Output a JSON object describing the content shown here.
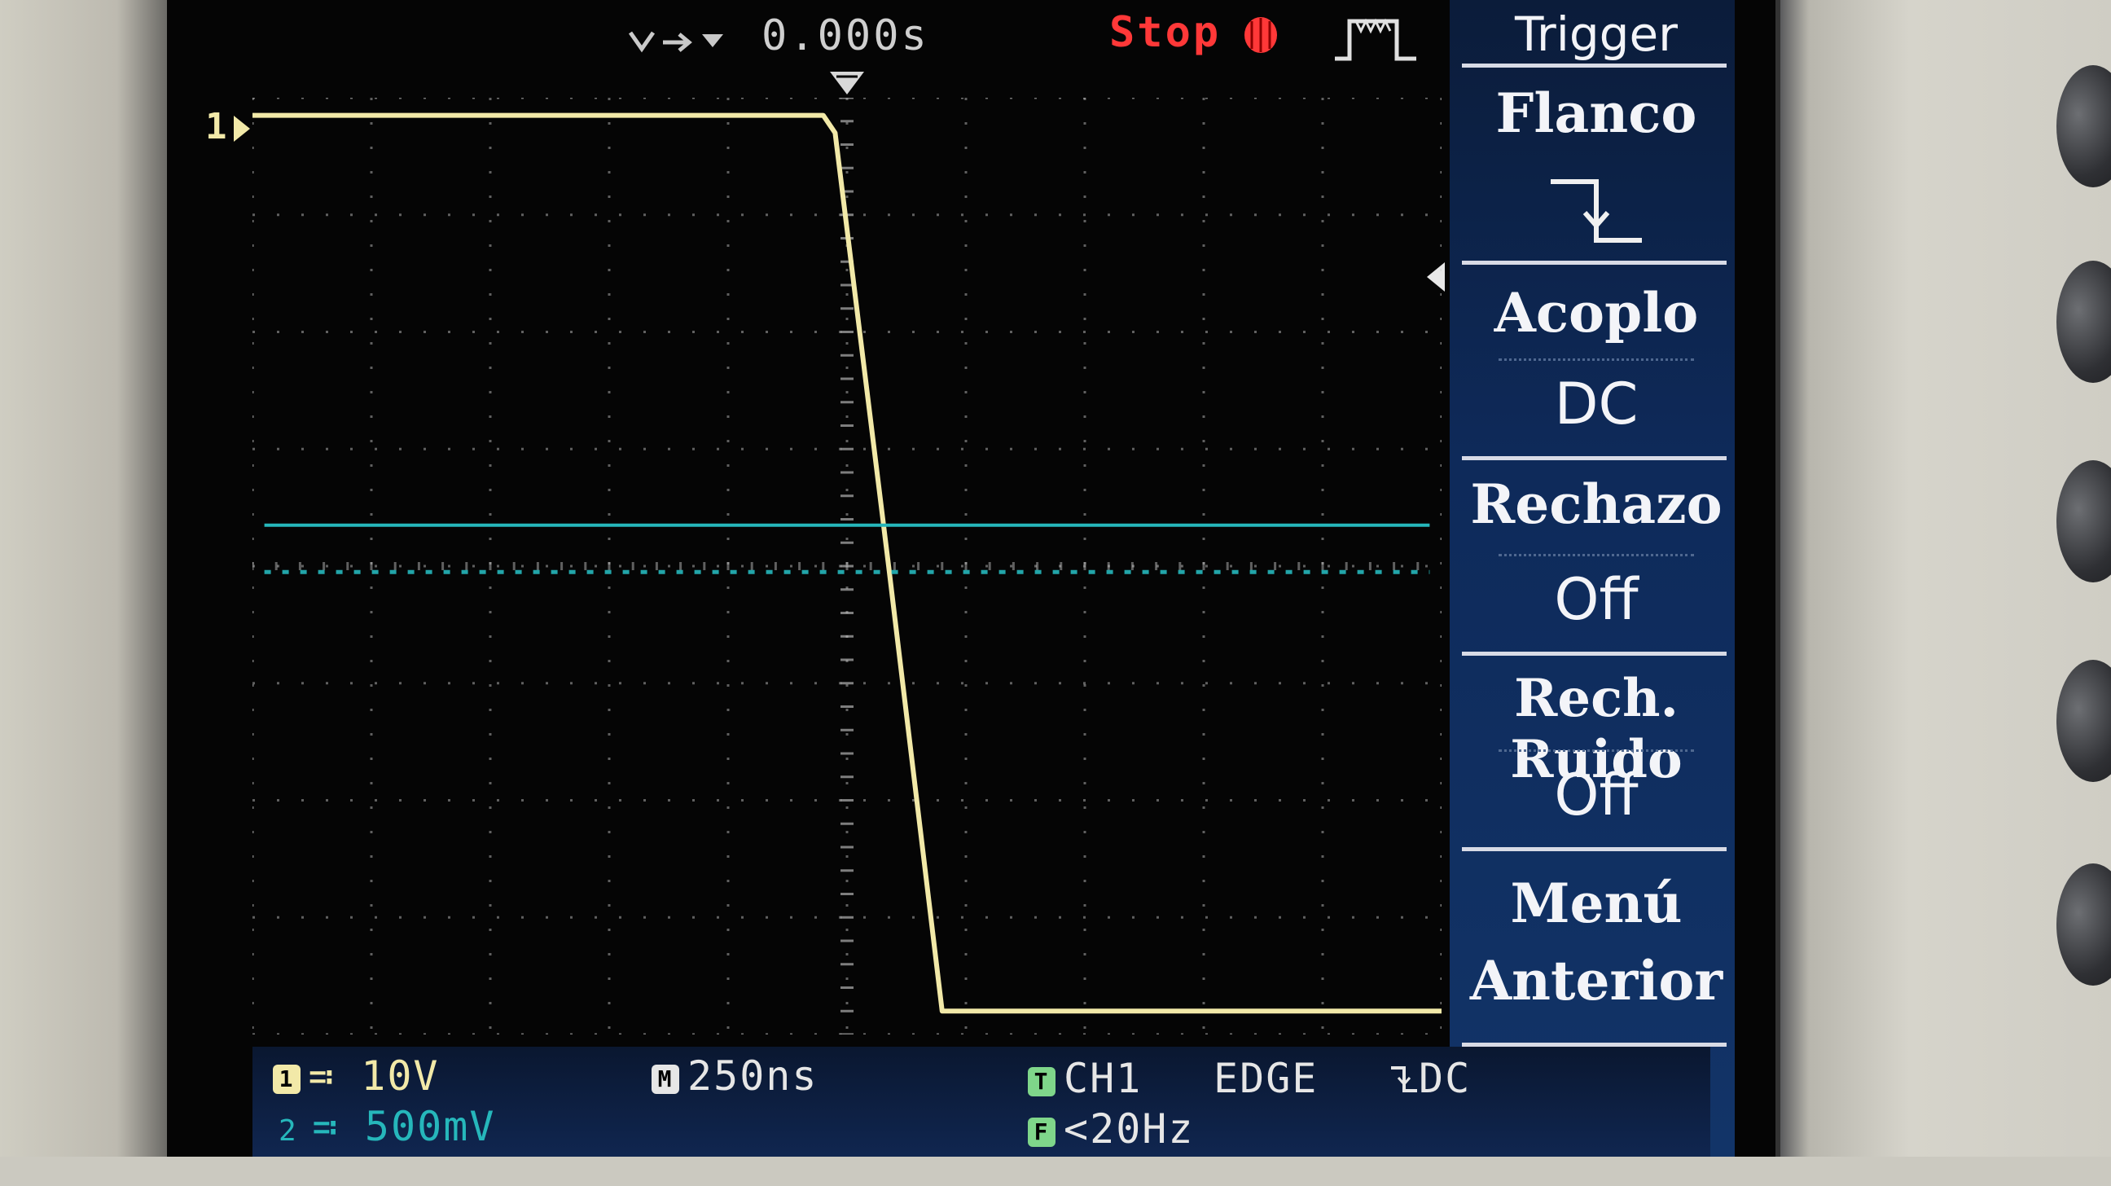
{
  "top_bar": {
    "time_offset": "0.000s",
    "run_state": "Stop",
    "run_state_color": "#ff3838",
    "trigger_position_marker": "T",
    "ch1_marker": "1"
  },
  "trigger_menu": {
    "title": "Trigger",
    "items": [
      {
        "label": "Flanco",
        "value_icon": "falling-edge-icon"
      },
      {
        "label": "Acoplo",
        "value": "DC"
      },
      {
        "label": "Rechazo",
        "value": "Off"
      },
      {
        "label": "Rech. Ruido",
        "value": "Off"
      },
      {
        "label": "Menú",
        "label2": "Anterior"
      }
    ]
  },
  "status_bar": {
    "ch1_index": "1",
    "ch1_scale": "10V",
    "ch2_index": "2",
    "ch2_scale": "500mV",
    "time_badge": "M",
    "timebase": "250ns",
    "trig_badge": "T",
    "trig_source": "CH1",
    "trig_type": "EDGE",
    "trig_coupling": "DC",
    "freq_badge": "F",
    "frequency": "<20Hz"
  },
  "colors": {
    "ch1": "#f2e9a8",
    "ch2": "#26b7bb",
    "grid": "#cfcfcf",
    "menu_bg": "#0f2c5e",
    "stop": "#ff3838"
  },
  "chart_data": {
    "type": "line",
    "title": "",
    "xlabel": "",
    "ylabel": "",
    "timebase_per_div": "250ns",
    "divisions": {
      "x": 10,
      "y": 8
    },
    "xlim_div": [
      -5,
      5
    ],
    "ylim_div": [
      -4,
      4
    ],
    "series": [
      {
        "name": "1",
        "color": "#f2e9a8",
        "points_div": [
          [
            -5,
            3.85
          ],
          [
            -0.2,
            3.85
          ],
          [
            -0.1,
            3.7
          ],
          [
            0.35,
            0.0
          ],
          [
            0.8,
            -3.8
          ],
          [
            5,
            -3.8
          ]
        ]
      },
      {
        "name": "2",
        "color": "#26b7bb",
        "points_div": [
          [
            -4.9,
            0.35
          ],
          [
            4.9,
            0.35
          ]
        ],
        "reference_points_div": [
          [
            -4.9,
            -0.05
          ],
          [
            4.9,
            -0.05
          ]
        ]
      }
    ]
  }
}
